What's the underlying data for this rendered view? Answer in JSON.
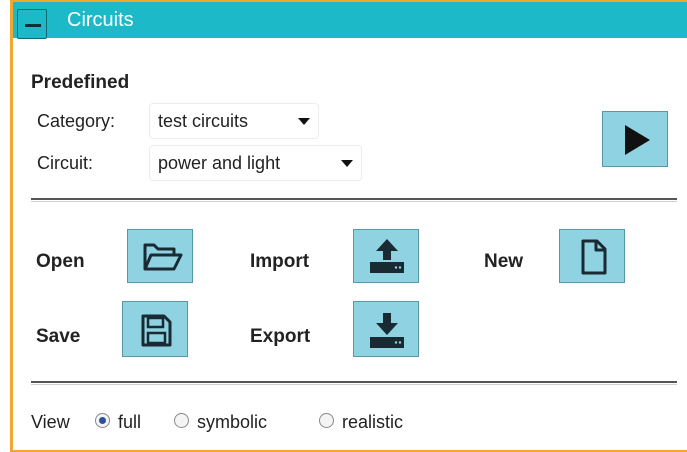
{
  "panel": {
    "title": "Circuits"
  },
  "predefined": {
    "heading": "Predefined",
    "category_label": "Category:",
    "category_value": "test circuits",
    "circuit_label": "Circuit:",
    "circuit_value": "power and light"
  },
  "file_actions": {
    "open_label": "Open",
    "import_label": "Import",
    "new_label": "New",
    "save_label": "Save",
    "export_label": "Export"
  },
  "view": {
    "label": "View",
    "options": [
      "full",
      "symbolic",
      "realistic"
    ],
    "selected": "full"
  },
  "icons": {
    "collapse": "minus-icon",
    "run": "play-icon",
    "open": "folder-open-icon",
    "import": "upload-icon",
    "new": "new-file-icon",
    "save": "floppy-disk-icon",
    "export": "download-icon"
  },
  "colors": {
    "titlebar": "#1cbac9",
    "button_fill": "#8fd3e3",
    "panel_border": "#f0a830",
    "radio_selected": "#2b4ea0"
  }
}
